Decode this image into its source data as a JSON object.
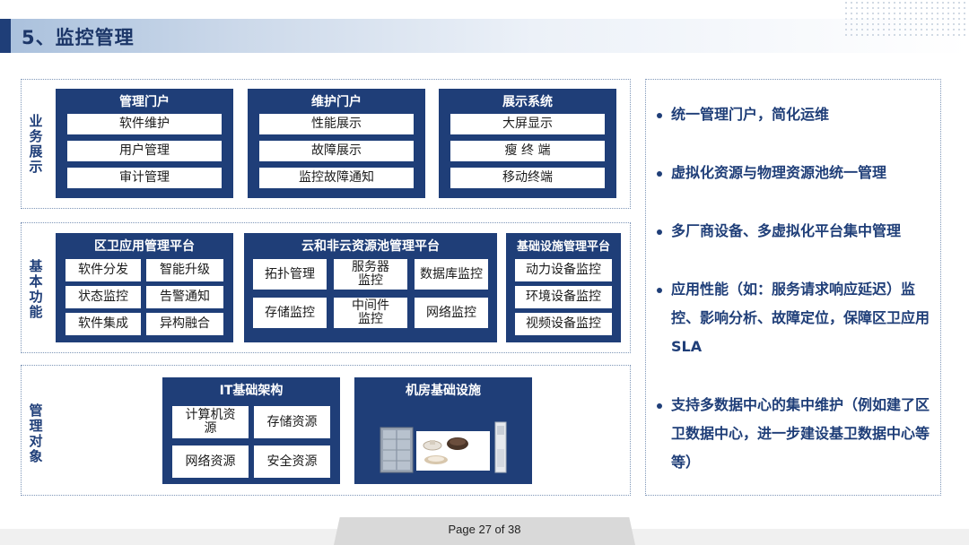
{
  "header": {
    "title": "5、监控管理"
  },
  "sections": {
    "business": {
      "label": "业务展示",
      "panels": [
        {
          "title": "管理门户",
          "items": [
            "软件维护",
            "用户管理",
            "审计管理"
          ]
        },
        {
          "title": "维护门户",
          "items": [
            "性能展示",
            "故障展示",
            "监控故障通知"
          ]
        },
        {
          "title": "展示系统",
          "items": [
            "大屏显示",
            "瘦 终 端",
            "移动终端"
          ]
        }
      ]
    },
    "function": {
      "label": "基本功能",
      "panels": [
        {
          "title": "区卫应用管理平台",
          "items": [
            "软件分发",
            "智能升级",
            "状态监控",
            "告警通知",
            "软件集成",
            "异构融合"
          ]
        },
        {
          "title": "云和非云资源池管理平台",
          "items": [
            "拓扑管理",
            "服务器监控",
            "数据库监控",
            "存储监控",
            "中间件监控",
            "网络监控"
          ]
        },
        {
          "title": "基础设施管理平台",
          "items": [
            "动力设备监控",
            "环境设备监控",
            "视频设备监控"
          ]
        }
      ]
    },
    "objects": {
      "label": "管理对象",
      "panels": [
        {
          "title": "IT基础架构",
          "items": [
            "计算机资源",
            "存储资源",
            "网络资源",
            "安全资源"
          ]
        },
        {
          "title": "机房基础设施"
        }
      ]
    }
  },
  "bullets": [
    "统一管理门户，简化运维",
    "虚拟化资源与物理资源池统一管理",
    "多厂商设备、多虚拟化平台集中管理",
    "应用性能（如：服务请求响应延迟）监控、影响分析、故障定位，保障区卫应用SLA",
    "支持多数据中心的集中维护（例如建了区卫数据中心，进一步建设基卫数据中心等等）"
  ],
  "footer": {
    "page": "Page 27 of 38"
  }
}
